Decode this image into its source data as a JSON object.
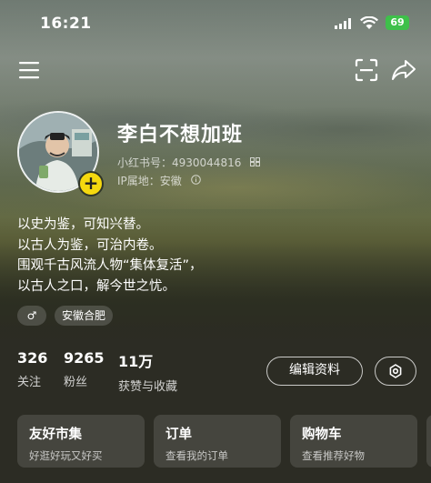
{
  "status_bar": {
    "time": "16:21",
    "battery": "69"
  },
  "profile": {
    "name": "李白不想加班",
    "id_line": "小红书号：4930044816",
    "ip_line": "IP属地：安徽",
    "bio": [
      "以史为鉴，可知兴替。",
      "以古人为鉴，可治内卷。",
      "围观千古风流人物“集体复活”，",
      "以古人之口，解今世之忧。"
    ],
    "tags": {
      "gender": "♂",
      "location": "安徽合肥"
    }
  },
  "stats": [
    {
      "value": "326",
      "label": "关注"
    },
    {
      "value": "9265",
      "label": "粉丝"
    },
    {
      "value": "11万",
      "label": "获赞与收藏"
    }
  ],
  "actions": {
    "edit_label": "编辑资料"
  },
  "cards": [
    {
      "title": "友好市集",
      "subtitle": "好逛好玩又好买"
    },
    {
      "title": "订单",
      "subtitle": "查看我的订单"
    },
    {
      "title": "购物车",
      "subtitle": "查看推荐好物"
    }
  ],
  "icons": [
    "menu-icon",
    "scan-icon",
    "share-icon",
    "settings-icon",
    "add-icon",
    "qr-icon",
    "info-icon",
    "male-icon"
  ],
  "colors": {
    "add_button": "#f5d80f",
    "battery": "#3ec04a"
  }
}
